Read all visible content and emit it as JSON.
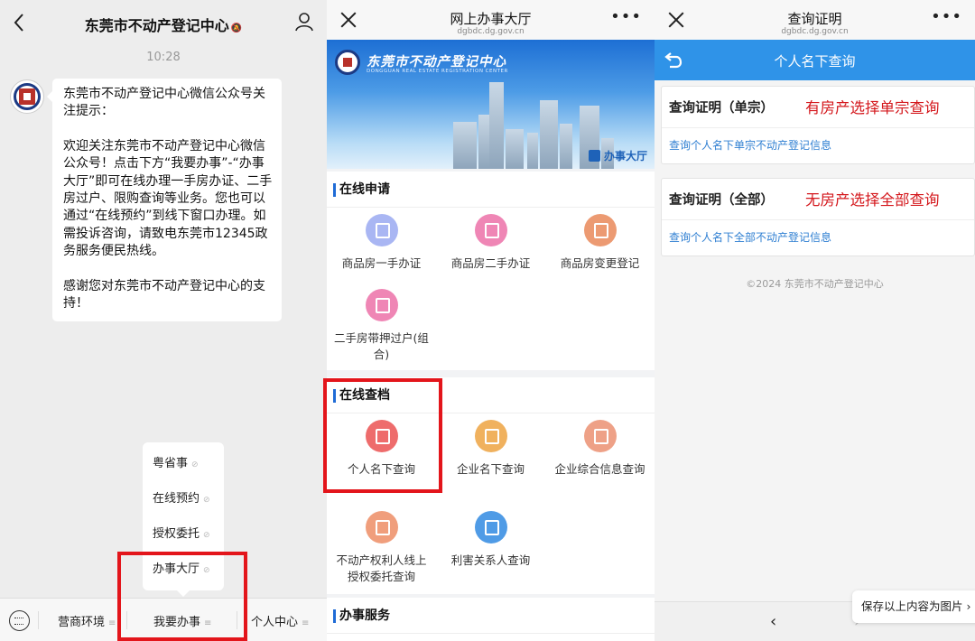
{
  "panel1": {
    "title": "东莞市不动产登记中心",
    "time": "10:28",
    "message": {
      "p1": "东莞市不动产登记中心微信公众号关注提示：",
      "p2": "欢迎关注东莞市不动产登记中心微信公众号！点击下方“我要办事”-“办事大厅”即可在线办理一手房办证、二手房过户、限购查询等业务。您也可以通过“在线预约”到线下窗口办理。如需投诉咨询，请致电东莞市12345政务服务便民热线。",
      "p3": "感谢您对东莞市不动产登记中心的支持！"
    },
    "popup_items": [
      "粤省事",
      "在线预约",
      "授权委托",
      "办事大厅"
    ],
    "menu": [
      "营商环境",
      "我要办事",
      "个人中心"
    ],
    "highlight_color": "#e3151b"
  },
  "panel2": {
    "title": "网上办事大厅",
    "domain": "dgbdc.dg.gov.cn",
    "banner_title": "东莞市不动产登记中心",
    "banner_en": "DONGGUAN REAL ESTATE REGISTRATION CENTER",
    "banner_tag": "办事大厅",
    "sections": {
      "apply": {
        "title": "在线申请",
        "items": [
          "商品房一手办证",
          "商品房二手办证",
          "商品房变更登记",
          "二手房带押过户(组合)"
        ]
      },
      "query": {
        "title": "在线查档",
        "items": [
          "个人名下查询",
          "企业名下查询",
          "企业综合信息查询",
          "不动产权利人线上授权委托查询",
          "利害关系人查询"
        ]
      },
      "service": {
        "title": "办事服务"
      }
    },
    "accent_color": "#1f6bd6"
  },
  "panel3": {
    "title": "查询证明",
    "domain": "dgbdc.dg.gov.cn",
    "bar_title": "个人名下查询",
    "cards": [
      {
        "title": "查询证明（单宗）",
        "note": "有房产选择单宗查询",
        "desc": "查询个人名下单宗不动产登记信息"
      },
      {
        "title": "查询证明（全部）",
        "note": "无房产选择全部查询",
        "desc": "查询个人名下全部不动产登记信息"
      }
    ],
    "copyright": "©2024 东莞市不动产登记中心",
    "save_button": "保存以上内容为图片",
    "bar_color": "#2f93e8"
  }
}
